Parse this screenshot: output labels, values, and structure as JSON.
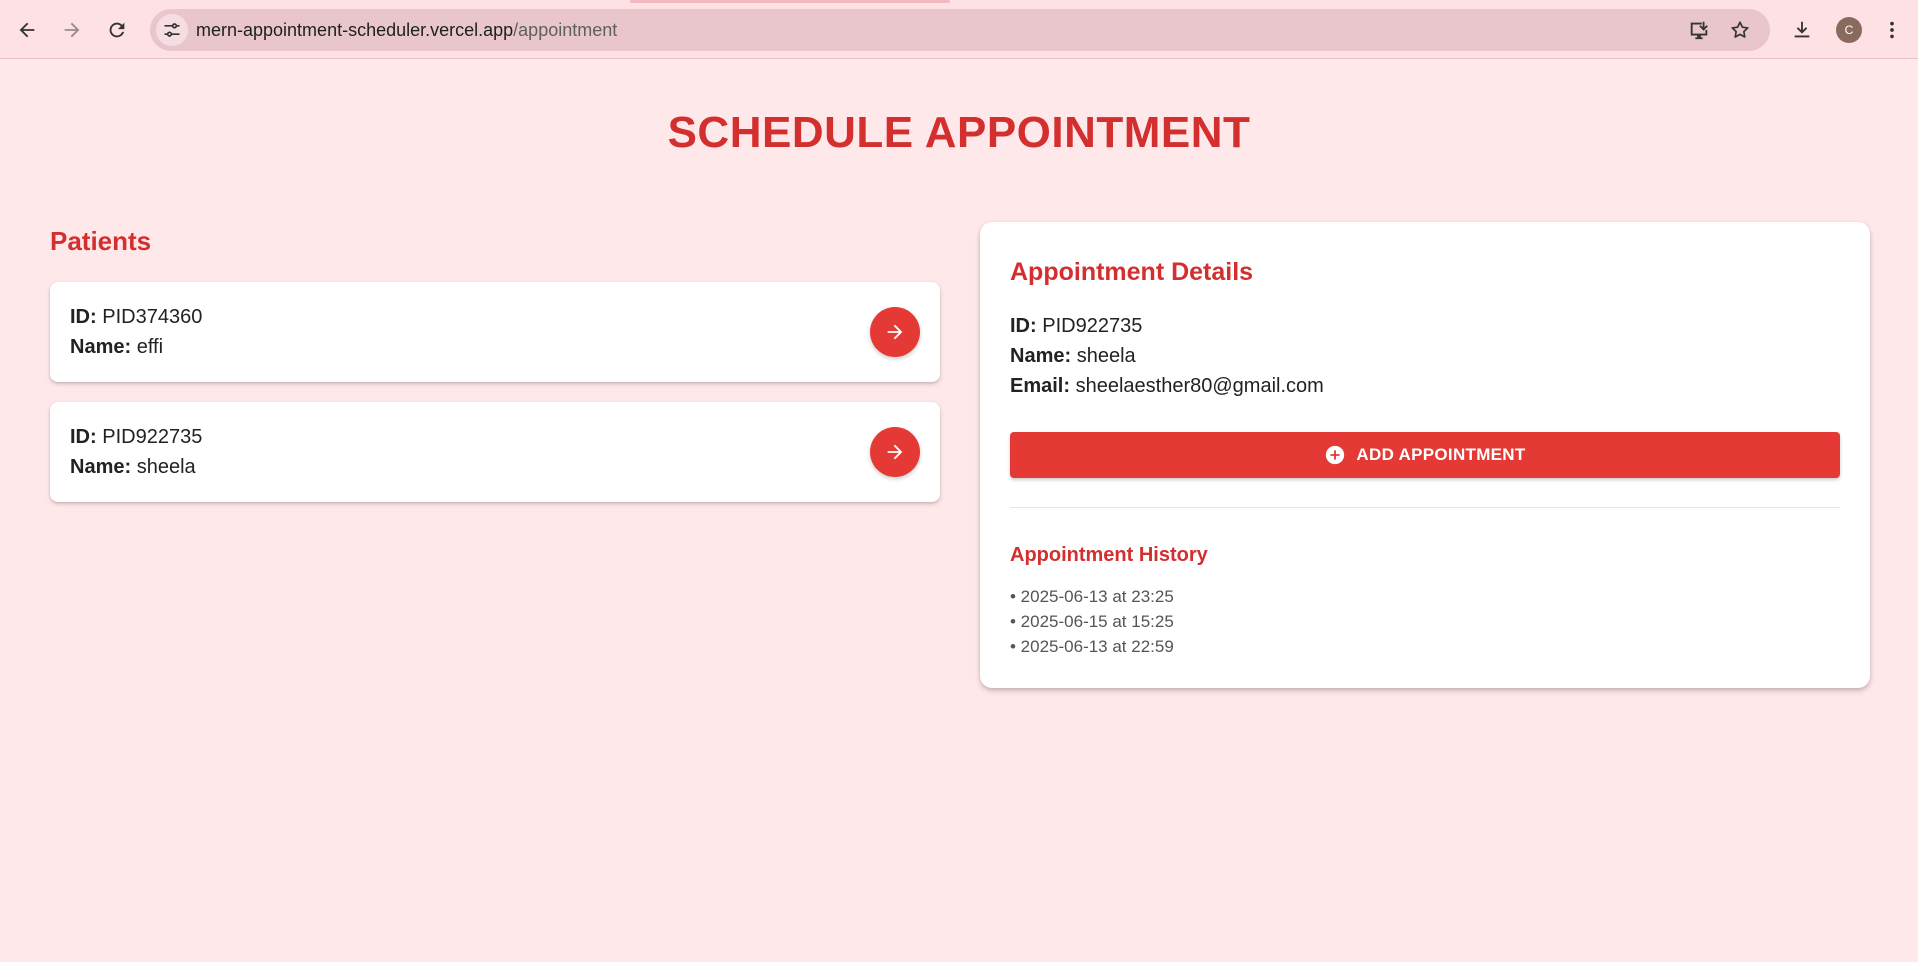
{
  "browser": {
    "url_host": "mern-appointment-scheduler.vercel.app",
    "url_path": "/appointment",
    "profile_initial": "C"
  },
  "page": {
    "title": "SCHEDULE APPOINTMENT",
    "patients_heading": "Patients"
  },
  "labels": {
    "id": "ID:",
    "name": "Name:",
    "email": "Email:"
  },
  "patients": [
    {
      "id": "PID374360",
      "name": "effi"
    },
    {
      "id": "PID922735",
      "name": "sheela"
    }
  ],
  "details": {
    "title": "Appointment Details",
    "id": "PID922735",
    "name": "sheela",
    "email": "sheelaesther80@gmail.com",
    "add_button": "ADD APPOINTMENT",
    "history_title": "Appointment History",
    "history": [
      "• 2025-06-13 at 23:25",
      "• 2025-06-15 at 15:25",
      "• 2025-06-13 at 22:59"
    ]
  },
  "colors": {
    "accent": "#d32f2f",
    "button": "#e53935",
    "background": "#ffe8ea"
  }
}
